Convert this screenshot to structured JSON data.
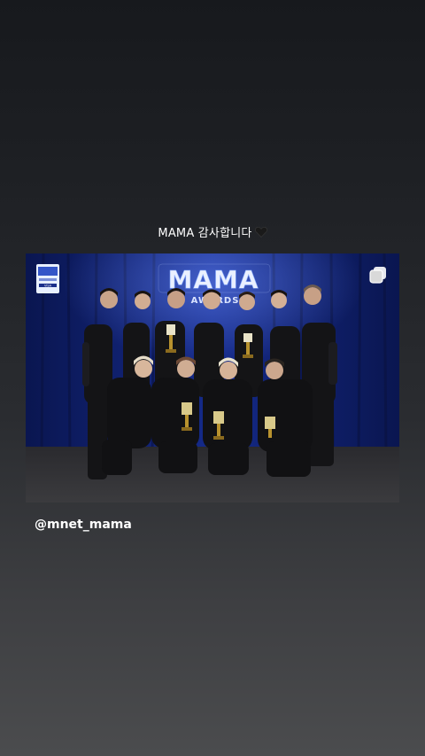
{
  "story": {
    "caption_text": "MAMA 감사합니다",
    "heart_icon": "black-heart-icon",
    "mention": "@mnet_mama"
  },
  "post": {
    "multi_icon": "multiple-posts-icon",
    "logo_text": "MAMA",
    "logo_subtext": "AWARDS",
    "sponsor_badge_text": "VISA"
  }
}
